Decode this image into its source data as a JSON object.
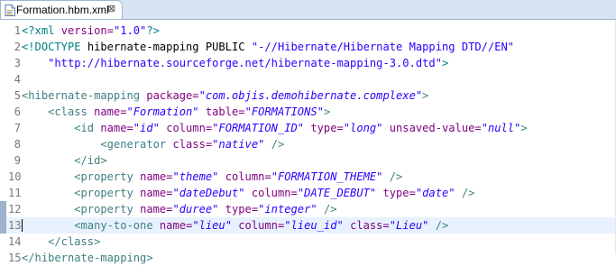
{
  "tab": {
    "label": "Formation.hbm.xml",
    "icon": "xml-file-icon",
    "close_glyph": "⊠"
  },
  "editor": {
    "current_line": 13,
    "changed_lines": [
      12,
      13
    ],
    "lines": [
      {
        "n": "1",
        "tokens": [
          [
            "proc",
            "<?xml "
          ],
          [
            "attr",
            "version="
          ],
          [
            "str",
            "\"1.0\""
          ],
          [
            "proc",
            "?>"
          ]
        ]
      },
      {
        "n": "2",
        "tokens": [
          [
            "proc",
            "<!DOCTYPE "
          ],
          [
            "plain",
            "hibernate-mapping "
          ],
          [
            "plain",
            "PUBLIC "
          ],
          [
            "str",
            "\"-//Hibernate/Hibernate Mapping DTD//EN\""
          ]
        ]
      },
      {
        "n": "3",
        "tokens": [
          [
            "plain",
            "    "
          ],
          [
            "str",
            "\"http://hibernate.sourceforge.net/hibernate-mapping-3.0.dtd\""
          ],
          [
            "proc",
            ">"
          ]
        ]
      },
      {
        "n": "4",
        "tokens": []
      },
      {
        "n": "5",
        "tokens": [
          [
            "tag",
            "<hibernate-mapping "
          ],
          [
            "attr",
            "package="
          ],
          [
            "val",
            "\"com.objis.demohibernate.complexe\""
          ],
          [
            "tag",
            ">"
          ]
        ]
      },
      {
        "n": "6",
        "tokens": [
          [
            "plain",
            "    "
          ],
          [
            "tag",
            "<class "
          ],
          [
            "attr",
            "name="
          ],
          [
            "val",
            "\"Formation\""
          ],
          [
            "plain",
            " "
          ],
          [
            "attr",
            "table="
          ],
          [
            "val",
            "\"FORMATIONS\""
          ],
          [
            "tag",
            ">"
          ]
        ]
      },
      {
        "n": "7",
        "tokens": [
          [
            "plain",
            "        "
          ],
          [
            "tag",
            "<id "
          ],
          [
            "attr",
            "name="
          ],
          [
            "val",
            "\"id\""
          ],
          [
            "plain",
            " "
          ],
          [
            "attr",
            "column="
          ],
          [
            "val",
            "\"FORMATION_ID\""
          ],
          [
            "plain",
            " "
          ],
          [
            "attr",
            "type="
          ],
          [
            "val",
            "\"long\""
          ],
          [
            "plain",
            " "
          ],
          [
            "attr",
            "unsaved-value="
          ],
          [
            "val",
            "\"null\""
          ],
          [
            "tag",
            ">"
          ]
        ]
      },
      {
        "n": "8",
        "tokens": [
          [
            "plain",
            "            "
          ],
          [
            "tag",
            "<generator "
          ],
          [
            "attr",
            "class="
          ],
          [
            "val",
            "\"native\""
          ],
          [
            "plain",
            " "
          ],
          [
            "tag",
            "/>"
          ]
        ]
      },
      {
        "n": "9",
        "tokens": [
          [
            "plain",
            "        "
          ],
          [
            "tag",
            "</id>"
          ]
        ]
      },
      {
        "n": "10",
        "tokens": [
          [
            "plain",
            "        "
          ],
          [
            "tag",
            "<property "
          ],
          [
            "attr",
            "name="
          ],
          [
            "val",
            "\"theme\""
          ],
          [
            "plain",
            " "
          ],
          [
            "attr",
            "column="
          ],
          [
            "val",
            "\"FORMATION_THEME\""
          ],
          [
            "plain",
            " "
          ],
          [
            "tag",
            "/>"
          ]
        ]
      },
      {
        "n": "11",
        "tokens": [
          [
            "plain",
            "        "
          ],
          [
            "tag",
            "<property "
          ],
          [
            "attr",
            "name="
          ],
          [
            "val",
            "\"dateDebut\""
          ],
          [
            "plain",
            " "
          ],
          [
            "attr",
            "column="
          ],
          [
            "val",
            "\"DATE_DEBUT\""
          ],
          [
            "plain",
            " "
          ],
          [
            "attr",
            "type="
          ],
          [
            "val",
            "\"date\""
          ],
          [
            "plain",
            " "
          ],
          [
            "tag",
            "/>"
          ]
        ]
      },
      {
        "n": "12",
        "tokens": [
          [
            "plain",
            "        "
          ],
          [
            "tag",
            "<property "
          ],
          [
            "attr",
            "name="
          ],
          [
            "val",
            "\"duree\""
          ],
          [
            "plain",
            " "
          ],
          [
            "attr",
            "type="
          ],
          [
            "val",
            "\"integer\""
          ],
          [
            "plain",
            " "
          ],
          [
            "tag",
            "/>"
          ]
        ]
      },
      {
        "n": "13",
        "tokens": [
          [
            "plain",
            "        "
          ],
          [
            "tag",
            "<many-to-one "
          ],
          [
            "attr",
            "name="
          ],
          [
            "val",
            "\"lieu\""
          ],
          [
            "plain",
            " "
          ],
          [
            "attr",
            "column="
          ],
          [
            "val",
            "\"lieu_id\""
          ],
          [
            "plain",
            " "
          ],
          [
            "attr",
            "class="
          ],
          [
            "val",
            "\"Lieu\""
          ],
          [
            "plain",
            " "
          ],
          [
            "tag",
            "/>"
          ]
        ]
      },
      {
        "n": "14",
        "tokens": [
          [
            "plain",
            "    "
          ],
          [
            "tag",
            "</class>"
          ]
        ]
      },
      {
        "n": "15",
        "tokens": [
          [
            "tag",
            "</hibernate-mapping>"
          ]
        ]
      }
    ]
  }
}
